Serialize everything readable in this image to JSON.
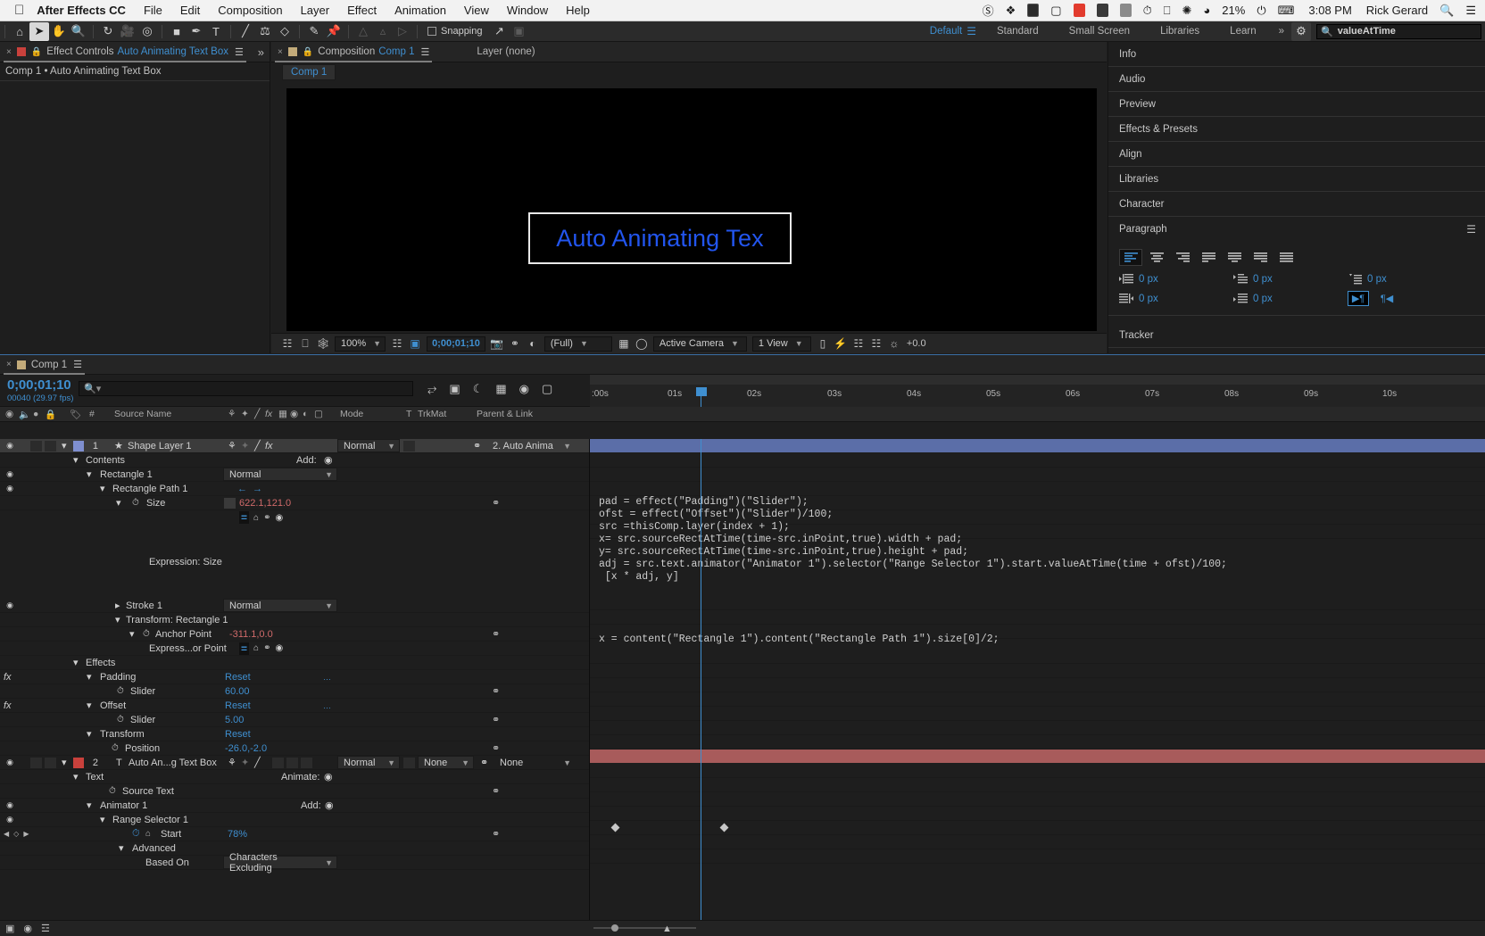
{
  "macbar": {
    "apple": "apple-logo",
    "app": "After Effects CC",
    "menus": [
      "File",
      "Edit",
      "Composition",
      "Layer",
      "Effect",
      "Animation",
      "View",
      "Window",
      "Help"
    ],
    "battery": "21%",
    "time": "3:08 PM",
    "user": "Rick Gerard"
  },
  "toolbar": {
    "snapping": "Snapping",
    "workspaces": [
      "Default",
      "Standard",
      "Small Screen",
      "Libraries",
      "Learn"
    ],
    "active_workspace": "Default",
    "overflow": "»",
    "search_value": "valueAtTime"
  },
  "effect_controls": {
    "close": "×",
    "title": "Effect Controls",
    "target": "Auto Animating Text Box",
    "subtitle": "Comp 1 • Auto Animating Text Box",
    "expand": "»"
  },
  "composition": {
    "close": "×",
    "title": "Composition",
    "name": "Comp 1",
    "layer_label": "Layer (none)",
    "breadcrumb": "Comp 1",
    "preview_text": "Auto Animating Tex",
    "preview_text_color": "#2255ee",
    "controls": {
      "zoom": "100%",
      "time": "0;00;01;10",
      "resolution": "(Full)",
      "camera": "Active Camera",
      "views": "1 View",
      "exposure": "+0.0"
    }
  },
  "right_dock": {
    "panels": [
      "Info",
      "Audio",
      "Preview",
      "Effects & Presets",
      "Align",
      "Libraries",
      "Character"
    ],
    "paragraph": {
      "title": "Paragraph",
      "indents": [
        "0 px",
        "0 px",
        "0 px",
        "0 px",
        "0 px"
      ]
    },
    "tracker": "Tracker"
  },
  "timeline": {
    "tab_close": "×",
    "tab_name": "Comp 1",
    "current_time": "0;00;01;10",
    "frame_fps": "00040 (29.97 fps)",
    "search_placeholder": "",
    "columns": [
      "#",
      "Source Name",
      "Mode",
      "T",
      "TrkMat",
      "Parent & Link"
    ],
    "ruler_ticks": [
      ":00s",
      "01s",
      "02s",
      "03s",
      "04s",
      "05s",
      "06s",
      "07s",
      "08s",
      "09s",
      "10s"
    ],
    "rows": [
      {
        "indent": 0,
        "eye": true,
        "num": "1",
        "name": "Shape Layer 1",
        "kind": "layer-shape",
        "mode": "Normal",
        "parent": "2. Auto Anima",
        "selected": true
      },
      {
        "indent": 1,
        "eye": false,
        "name": "Contents",
        "add": "Add:",
        "kind": "group"
      },
      {
        "indent": 2,
        "eye": true,
        "name": "Rectangle 1",
        "mode": "Normal",
        "kind": "group"
      },
      {
        "indent": 3,
        "eye": true,
        "name": "Rectangle Path 1",
        "kind": "path"
      },
      {
        "indent": 4,
        "eye": false,
        "name": "Size",
        "value": "622.1,121.0",
        "kind": "prop",
        "stopwatch": true
      },
      {
        "indent": 0,
        "eye": false,
        "name": "",
        "kind": "exprbtns"
      },
      {
        "indent": 0,
        "eye": false,
        "name": "Expression: Size",
        "kind": "exprlabel"
      },
      {
        "indent": 2,
        "eye": true,
        "name": "Stroke 1",
        "mode": "Normal",
        "kind": "group",
        "collapsed": true
      },
      {
        "indent": 2,
        "eye": false,
        "name": "Transform: Rectangle 1",
        "kind": "group"
      },
      {
        "indent": 3,
        "eye": false,
        "name": "Anchor Point",
        "value": "-311.1,0.0",
        "kind": "prop",
        "stopwatch": true
      },
      {
        "indent": 4,
        "eye": false,
        "name": "Express...or Point",
        "kind": "exprbtns2"
      },
      {
        "indent": 1,
        "eye": false,
        "name": "Effects",
        "kind": "group"
      },
      {
        "indent": 2,
        "eye": false,
        "fx": true,
        "name": "Padding",
        "value": "Reset",
        "valclass": "blue",
        "kind": "effect"
      },
      {
        "indent": 3,
        "eye": false,
        "name": "Slider",
        "value": "60.00",
        "valclass": "blue",
        "kind": "prop",
        "stopwatch": true
      },
      {
        "indent": 2,
        "eye": false,
        "fx": true,
        "name": "Offset",
        "value": "Reset",
        "valclass": "blue",
        "kind": "effect"
      },
      {
        "indent": 3,
        "eye": false,
        "name": "Slider",
        "value": "5.00",
        "valclass": "blue",
        "kind": "prop",
        "stopwatch": true
      },
      {
        "indent": 2,
        "eye": false,
        "name": "Transform",
        "value": "Reset",
        "valclass": "blue",
        "kind": "group"
      },
      {
        "indent": 3,
        "eye": false,
        "name": "Position",
        "value": "-26.0,-2.0",
        "valclass": "blue",
        "kind": "prop",
        "stopwatch": true
      },
      {
        "indent": 0,
        "eye": true,
        "num": "2",
        "name": "Auto An...g Text Box",
        "kind": "layer-text",
        "mode": "Normal",
        "trkmat": "None",
        "parent": "None"
      },
      {
        "indent": 1,
        "eye": false,
        "name": "Text",
        "add": "Animate:",
        "kind": "group"
      },
      {
        "indent": 2,
        "eye": false,
        "name": "Source Text",
        "kind": "prop",
        "stopwatch": true
      },
      {
        "indent": 2,
        "eye": true,
        "name": "Animator 1",
        "add": "Add:",
        "kind": "group"
      },
      {
        "indent": 3,
        "eye": true,
        "name": "Range Selector 1",
        "kind": "group"
      },
      {
        "indent": 4,
        "eye": false,
        "name": "Start",
        "value": "78%",
        "valclass": "pct",
        "kind": "prop",
        "stopwatch": true,
        "keyframed": true
      },
      {
        "indent": 4,
        "eye": false,
        "name": "Advanced",
        "kind": "group"
      },
      {
        "indent": 5,
        "eye": false,
        "name": "Based On",
        "mode": "Characters Excluding",
        "kind": "select"
      }
    ],
    "expression_size": "pad = effect(\"Padding\")(\"Slider\");\nofst = effect(\"Offset\")(\"Slider\")/100;\nsrc =thisComp.layer(index + 1);\nx= src.sourceRectAtTime(time-src.inPoint,true).width + pad;\ny= src.sourceRectAtTime(time-src.inPoint,true).height + pad;\nadj = src.text.animator(\"Animator 1\").selector(\"Range Selector 1\").start.valueAtTime(time + ofst)/100;\n [x * adj, y]",
    "expression_anchor": "x = content(\"Rectangle 1\").content(\"Rectangle Path 1\").size[0]/2;"
  }
}
